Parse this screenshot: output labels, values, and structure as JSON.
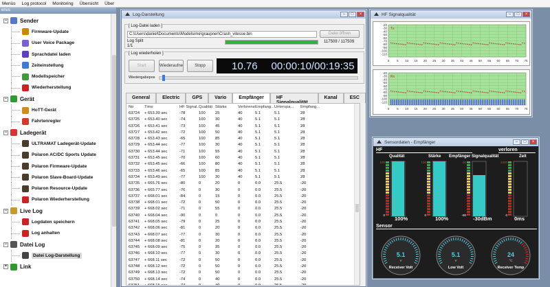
{
  "menubar": [
    "Menüs",
    "Log protocol",
    "Monitoring",
    "Übersicht",
    "Über"
  ],
  "tree": {
    "header": "enus",
    "categories": [
      {
        "label": "Sender",
        "expand": "−",
        "icon_color": "#5577cc",
        "children": [
          {
            "label": "Firmware-Update",
            "icon_color": "#cc8800"
          },
          {
            "label": "User Voice Package",
            "icon_color": "#7a5fd6"
          },
          {
            "label": "Sprachdatei laden",
            "icon_color": "#5b3fc4"
          },
          {
            "label": "Zeiteinstellung",
            "icon_color": "#3c7bd9"
          },
          {
            "label": "Modellspeicher",
            "icon_color": "#3d9a3d"
          },
          {
            "label": "Wiederherstellung",
            "icon_color": "#cc2222"
          }
        ]
      },
      {
        "label": "Gerät",
        "expand": "−",
        "icon_color": "#2f9b2f",
        "children": [
          {
            "label": "HoTT-Gerät",
            "icon_color": "#d38b1d"
          },
          {
            "label": "Fahrtenregler",
            "icon_color": "#cf3a2a"
          }
        ]
      },
      {
        "label": "Ladegerät",
        "expand": "−",
        "icon_color": "#d33",
        "children": [
          {
            "label": "ULTRAMAT Ladegerät-Update",
            "icon_color": "#4a3b2a"
          },
          {
            "label": "Polaron AC/DC Sports Update",
            "icon_color": "#4a3b2a"
          },
          {
            "label": "Polaron Firmware-Update",
            "icon_color": "#4a3b2a"
          },
          {
            "label": "Polaron Slave-Board-Update",
            "icon_color": "#4a3b2a"
          },
          {
            "label": "Polaron Resource-Update",
            "icon_color": "#4a3b2a"
          },
          {
            "label": "Polaron Wiederherstellung",
            "icon_color": "#cc2222"
          }
        ]
      },
      {
        "label": "Live Log",
        "expand": "−",
        "icon_color": "#c89a2a",
        "children": [
          {
            "label": "Logdaten speichern",
            "icon_color": "#cc2222"
          },
          {
            "label": "Log anhalten",
            "icon_color": "#cc2222"
          }
        ]
      },
      {
        "label": "Datei Log",
        "expand": "−",
        "icon_color": "#555",
        "children": [
          {
            "label": "Datei Log-Darstellung",
            "icon_color": "#444",
            "selected": true
          }
        ]
      },
      {
        "label": "Link",
        "expand": "+",
        "icon_color": "#2f9b2f",
        "children": []
      }
    ]
  },
  "logwin": {
    "title": "Log-Darstellung",
    "load_group": "Log-Datei laden",
    "path": "C:\\Users\\daniel\\Documents\\Modelsime\\graupner\\Crash_vitesse.bin",
    "open_btn": "Datei öffnen",
    "split_label": "Log Split",
    "split_count": "1/1",
    "progress_fraction": 1.0,
    "progress_text": "117509 / 117509",
    "repeat_group": "Log wiederholen",
    "start_btn": "Start",
    "resume_btn": "Wiederaufnehme",
    "stop_btn": "Stopp",
    "lcd_value": "10.76",
    "lcd_time": "00:00:10/00:19:35",
    "speed_label": "Wiedergabepos",
    "tabs": [
      "General",
      "Electric",
      "GPS",
      "Vario",
      "Empfänger",
      "HF Signalqualität",
      "Kanal",
      "ESC"
    ],
    "active_tab": "Empfänger",
    "columns": [
      "No",
      "Time",
      "HF Signal...",
      "Qualität",
      "Stärke",
      "Verlorene...",
      "Empfang...",
      "Unterspa...",
      "Empfang..."
    ],
    "rows": [
      [
        "63724",
        "+ 653.39 sec",
        "-78",
        "100",
        "25",
        "40",
        "5.1",
        "5.1",
        "28"
      ],
      [
        "63725",
        "+ 653.40 sec",
        "-74",
        "100",
        "30",
        "40",
        "5.1",
        "5.1",
        "28"
      ],
      [
        "63726",
        "+ 653.41 sec",
        "-73",
        "100",
        "45",
        "40",
        "5.1",
        "5.1",
        "28"
      ],
      [
        "63727",
        "+ 653.42 sec",
        "-72",
        "100",
        "50",
        "40",
        "5.1",
        "5.1",
        "28"
      ],
      [
        "63728",
        "+ 653.43 sec",
        "-65",
        "100",
        "85",
        "40",
        "5.1",
        "5.1",
        "28"
      ],
      [
        "63729",
        "+ 653.44 sec",
        "-77",
        "100",
        "30",
        "40",
        "5.1",
        "5.1",
        "28"
      ],
      [
        "63730",
        "+ 653.44 sec",
        "-71",
        "100",
        "55",
        "40",
        "5.1",
        "5.1",
        "28"
      ],
      [
        "63731",
        "+ 653.45 sec",
        "-70",
        "100",
        "60",
        "40",
        "5.1",
        "5.1",
        "28"
      ],
      [
        "63732",
        "+ 653.45 sec",
        "-66",
        "100",
        "80",
        "40",
        "5.1",
        "5.1",
        "28"
      ],
      [
        "63733",
        "+ 653.46 sec",
        "-65",
        "100",
        "85",
        "40",
        "5.1",
        "5.1",
        "28"
      ],
      [
        "63734",
        "+ 653.49 sec",
        "-77",
        "100",
        "30",
        "40",
        "5.1",
        "5.1",
        "28"
      ],
      [
        "63735",
        "+ 665.76 sec",
        "-80",
        "0",
        "20",
        "0",
        "0.0",
        "25.5",
        "-20"
      ],
      [
        "63736",
        "+ 665.77 sec",
        "-76",
        "0",
        "30",
        "0",
        "0.0",
        "25.5",
        "-20"
      ],
      [
        "63737",
        "+ 668.01 sec",
        "-84",
        "0",
        "15",
        "0",
        "0.0",
        "25.5",
        "-20"
      ],
      [
        "63738",
        "+ 668.01 sec",
        "-72",
        "0",
        "50",
        "0",
        "0.0",
        "25.5",
        "-20"
      ],
      [
        "63739",
        "+ 668.02 sec",
        "-71",
        "0",
        "55",
        "0",
        "0.0",
        "25.5",
        "-20"
      ],
      [
        "63740",
        "+ 668.04 sec",
        "-90",
        "0",
        "0",
        "0",
        "0.0",
        "25.5",
        "-20"
      ],
      [
        "63741",
        "+ 668.05 sec",
        "-79",
        "0",
        "25",
        "0",
        "0.0",
        "25.5",
        "-20"
      ],
      [
        "63742",
        "+ 668.06 sec",
        "-81",
        "0",
        "20",
        "0",
        "0.0",
        "25.5",
        "-20"
      ],
      [
        "63743",
        "+ 668.07 sec",
        "-77",
        "0",
        "30",
        "0",
        "0.0",
        "25.5",
        "-20"
      ],
      [
        "63744",
        "+ 668.08 sec",
        "-81",
        "0",
        "20",
        "0",
        "0.0",
        "25.5",
        "-20"
      ],
      [
        "63745",
        "+ 668.09 sec",
        "-75",
        "0",
        "35",
        "0",
        "0.0",
        "25.5",
        "-20"
      ],
      [
        "63746",
        "+ 668.10 sec",
        "-77",
        "0",
        "30",
        "0",
        "0.0",
        "25.5",
        "-20"
      ],
      [
        "63747",
        "+ 668.11 sec",
        "-72",
        "0",
        "50",
        "0",
        "0.0",
        "25.5",
        "-20"
      ],
      [
        "63748",
        "+ 668.12 sec",
        "-72",
        "0",
        "50",
        "0",
        "0.0",
        "25.5",
        "-20"
      ],
      [
        "63749",
        "+ 668.13 sec",
        "-72",
        "0",
        "50",
        "0",
        "0.0",
        "25.5",
        "-20"
      ],
      [
        "63750",
        "+ 668.14 sec",
        "-74",
        "0",
        "40",
        "0",
        "0.0",
        "25.5",
        "-20"
      ],
      [
        "63751",
        "+ 668.15 sec",
        "-74",
        "0",
        "40",
        "0",
        "0.0",
        "25.5",
        "-20"
      ]
    ]
  },
  "hfwin": {
    "title": "HF Signalqualität",
    "top_tag": "Tx",
    "bottom_tag": "Rx",
    "y_ticks": [
      "-120",
      "-110",
      "-100",
      "-90",
      "-80",
      "-70",
      "-60",
      "-50",
      "-40",
      "-30",
      "-20"
    ],
    "x_ticks": [
      "0",
      "5",
      "10",
      "15",
      "20",
      "25",
      "30",
      "35",
      "40",
      "45",
      "50",
      "55",
      "60",
      "65",
      "70",
      "75"
    ]
  },
  "sensorwin": {
    "title": "Sensordaten - Empfänger",
    "hf_title": "HF",
    "verloren_title": "verloren",
    "sensor_title": "Sensor",
    "labels": {
      "qualitaet": "Qualität",
      "staerke": "Stärke",
      "signalqual": "Empfänger Signalqualität",
      "zeit": "Zeit"
    },
    "values": {
      "qualitaet": "100%",
      "staerke": "100%",
      "signal": "-30dBm",
      "zeit": "0ms"
    },
    "levels": {
      "qualitaet": 1.0,
      "staerke": 1.0,
      "signal": 0.75,
      "zeit": 0.0
    },
    "scales": {
      "qualitaet": [
        "100",
        "0"
      ],
      "staerke": [
        "100",
        "0"
      ],
      "signal": [
        "-30",
        "-90"
      ],
      "zeit": [
        "2000",
        "0"
      ]
    },
    "gauges": [
      {
        "name": "Receiver Volt",
        "value": "5.1",
        "unit": "V"
      },
      {
        "name": "Low Volt",
        "value": "5.1",
        "unit": "V"
      },
      {
        "name": "Receiver Temp",
        "value": "24",
        "unit": "°C"
      }
    ]
  },
  "colors": {
    "accent": "#2fb33c",
    "chart_bg": "#a6e29a",
    "bar_blue": "#3d3df5",
    "bar_red": "#cc1f1f",
    "bar_yellow": "#e7d23a",
    "bar_green": "#22b34b",
    "bar_cyan": "#35c9c8"
  }
}
